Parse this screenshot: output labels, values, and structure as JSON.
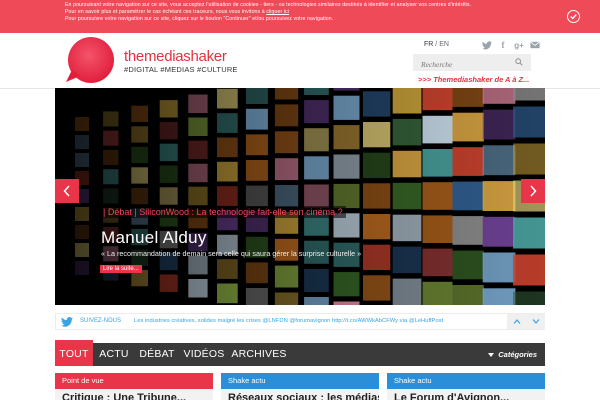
{
  "cookie": {
    "line1": "En poursuivant votre navigation sur ce site, vous acceptez l'utilisation de cookies - tiers - ou technologies similaires destinés à identifier et analyser vos centres d'intérêts.",
    "line2_prefix": "Pour en savoir plus et paramétrer le cas échéant ces traceurs, nous vous invitons à ",
    "line2_link": "cliquer ici",
    "line3": "Pour poursuivre votre navigation sur ce site, cliquez sur le bouton \"Continuer\" et/ou poursuivez votre navigation.",
    "ok_icon": "check-icon"
  },
  "header": {
    "brand": "themediashaker",
    "tagline": "#DIGITAL #MEDIAS #CULTURE",
    "lang_fr": "FR",
    "lang_sep": " / ",
    "lang_en": "EN",
    "social": [
      {
        "name": "twitter-icon",
        "glyph": "🐦"
      },
      {
        "name": "facebook-icon",
        "glyph": "f"
      },
      {
        "name": "google-plus-icon",
        "glyph": "g+"
      },
      {
        "name": "mail-icon",
        "glyph": "✉"
      }
    ],
    "search_placeholder": "Recherche",
    "az_link": ">>> Themediashaker de A à Z..."
  },
  "hero": {
    "category": "| Débat | SiliconWood : La technologie fait-elle son cinéma ?",
    "author": "Manuel Alduy",
    "quote": "« La recommandation de demain sera celle qui saura gérer la surprise culturelle »",
    "read_more": "Lire la suite..."
  },
  "twitter": {
    "follow": "SUIVEZ-NOUS",
    "tweet": "Les industries créatives, solides malgré les crises @LNFDN @forumavignon http://t.co/AWWkAbCFWy via @LeHuffPost"
  },
  "nav": {
    "items": [
      "TOUT",
      "ACTU",
      "DÉBAT",
      "VIDÉOS",
      "ARCHIVES"
    ],
    "categories": "Catégories"
  },
  "cards": [
    {
      "label": "Point de vue",
      "color": "#e8354a",
      "title": "Critique : Une Tribune..."
    },
    {
      "label": "Shake actu",
      "color": "#2a8fd8",
      "title": "Réseaux sociaux : les médias..."
    },
    {
      "label": "Shake actu",
      "color": "#2a8fd8",
      "title": "Le Forum d'Avignon..."
    }
  ],
  "colors": {
    "accent": "#e8354a",
    "twitter": "#3aa3e3",
    "nav_bg": "#3a3a3a"
  }
}
